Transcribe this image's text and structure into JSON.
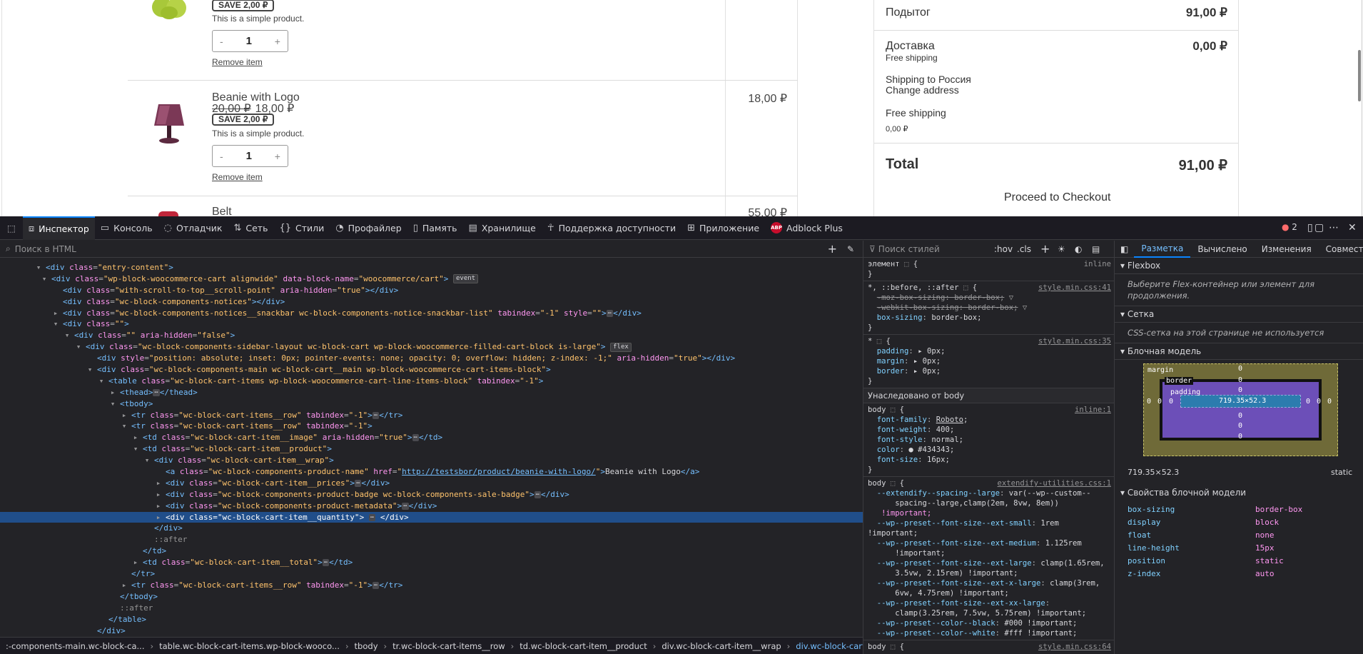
{
  "page": {
    "item1": {
      "badge": "SAVE 2,00 ₽",
      "desc": "This is a simple product.",
      "qty_minus": "-",
      "qty": "1",
      "qty_plus": "+",
      "remove": "Remove item"
    },
    "item2": {
      "name": "Beanie with Logo",
      "price_old": "20,00 ₽",
      "price_new": "18,00 ₽",
      "badge": "SAVE 2,00 ₽",
      "desc": "This is a simple product.",
      "qty_minus": "-",
      "qty": "1",
      "qty_plus": "+",
      "remove": "Remove item",
      "total": "18,00 ₽"
    },
    "item3": {
      "name": "Belt",
      "total": "55,00 ₽"
    },
    "sidebar": {
      "subtotal_label": "Подытог",
      "subtotal_value": "91,00 ₽",
      "shipping_label": "Доставка",
      "shipping_value": "0,00 ₽",
      "shipping_note": "Free shipping",
      "shipping_to": "Shipping to Россия",
      "change_address": "Change address",
      "free_shipping": "Free shipping",
      "free_shipping_price": "0,00 ₽",
      "total_label": "Total",
      "total_value": "91,00 ₽",
      "checkout": "Proceed to Checkout"
    }
  },
  "devtools": {
    "tabs": [
      "Инспектор",
      "Консоль",
      "Отладчик",
      "Сеть",
      "Стили",
      "Профайлер",
      "Память",
      "Хранилище",
      "Поддержка доступности",
      "Приложение",
      "Adblock Plus"
    ],
    "tab_icons": [
      "inspector-icon",
      "console-icon",
      "debugger-icon",
      "network-icon",
      "styles-icon",
      "profiler-icon",
      "memory-icon",
      "storage-icon",
      "accessibility-icon",
      "application-icon",
      "adblock-icon"
    ],
    "abp_logo": "ABP",
    "error_count": "2",
    "html_search_placeholder": "Поиск в HTML",
    "styles_filter_placeholder": "Поиск стилей",
    "hov": ":hov",
    "cls": ".cls",
    "breadcrumbs": [
      ":-components-main.wc-block-ca...",
      "table.wc-block-cart-items.wp-block-wooco...",
      "tbody",
      "tr.wc-block-cart-items__row",
      "td.wc-block-cart-item__product",
      "div.wc-block-cart-item__wrap",
      "div.wc-block-cart-item__quantity"
    ],
    "inherited_label": "Унаследовано от body",
    "layout_tabs": [
      "Разметка",
      "Вычислено",
      "Изменения",
      "Совмести"
    ],
    "flexbox_title": "Flexbox",
    "flexbox_note": "Выберите Flex-контейнер или элемент для продолжения.",
    "grid_title": "Сетка",
    "grid_note": "CSS-сетка на этой странице не используется",
    "boxmodel_title": "Блочная модель",
    "bm_margin": "margin",
    "bm_border": "border",
    "bm_padding": "padding",
    "bm_zero": "0",
    "bm_size": "719.35×52.3",
    "bm_size_under": "719.35×52.3",
    "bm_position": "static",
    "props_title": "Свойства блочной модели",
    "props": [
      {
        "k": "box-sizing",
        "v": "border-box"
      },
      {
        "k": "display",
        "v": "block"
      },
      {
        "k": "float",
        "v": "none"
      },
      {
        "k": "line-height",
        "v": "15px"
      },
      {
        "k": "position",
        "v": "static"
      },
      {
        "k": "z-index",
        "v": "auto"
      }
    ]
  },
  "colors": {
    "accent": "#0a84ff",
    "devtools_bg": "#232327",
    "selected_row": "#204e8a"
  }
}
